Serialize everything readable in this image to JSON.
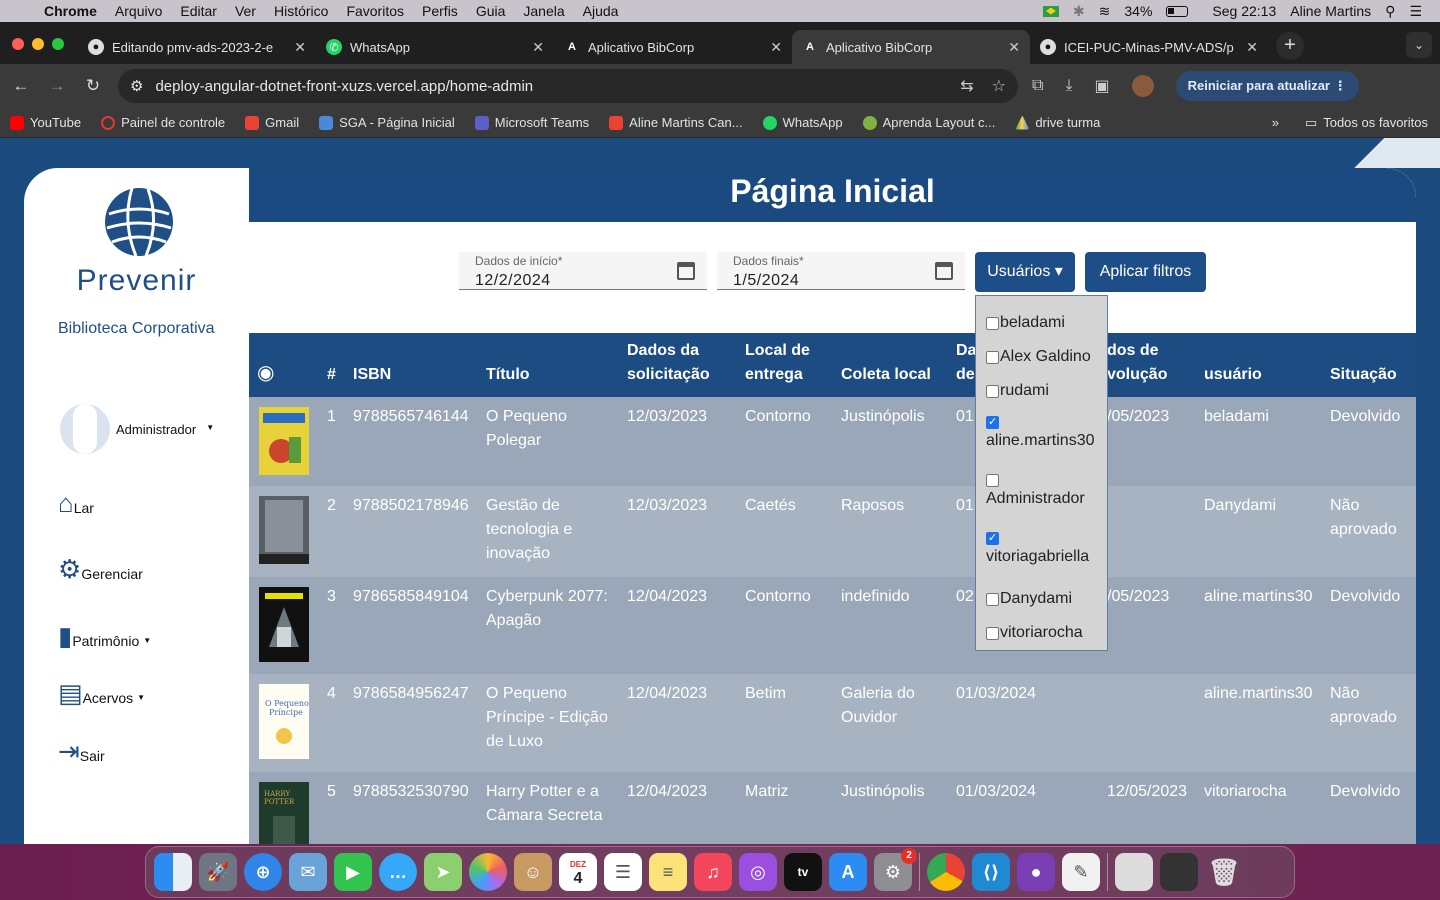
{
  "menubar": {
    "items": [
      "Chrome",
      "Arquivo",
      "Editar",
      "Ver",
      "Histórico",
      "Favoritos",
      "Perfis",
      "Guia",
      "Janela",
      "Ajuda"
    ],
    "battery": "34%",
    "clock": "Seg 22:13",
    "user": "Aline Martins"
  },
  "tabs": [
    {
      "title": "Editando pmv-ads-2023-2-e",
      "icon": "github-icon"
    },
    {
      "title": "WhatsApp",
      "icon": "whatsapp-icon"
    },
    {
      "title": "Aplicativo BibCorp",
      "icon": "angular-icon"
    },
    {
      "title": "Aplicativo BibCorp",
      "icon": "angular-icon"
    },
    {
      "title": "ICEI-PUC-Minas-PMV-ADS/p",
      "icon": "github-icon"
    }
  ],
  "toolbar": {
    "url": "deploy-angular-dotnet-front-xuzs.vercel.app/home-admin",
    "update_label": "Reiniciar para atualizar"
  },
  "bookmarks": [
    "YouTube",
    "Painel de controle",
    "Gmail",
    "SGA - Página Inicial",
    "Microsoft Teams",
    "Aline Martins Can...",
    "WhatsApp",
    "Aprenda Layout c...",
    "drive turma"
  ],
  "bookmarks_all": "Todos os favoritos",
  "sidebar": {
    "brand": "Prevenir",
    "subtitle": "Biblioteca Corporativa",
    "user": "Administrador",
    "items": [
      {
        "label": "Lar",
        "icon": "home-icon"
      },
      {
        "label": "Gerenciar",
        "icon": "gear-icon"
      },
      {
        "label": "Patrimônio",
        "icon": "book-icon"
      },
      {
        "label": "Acervos",
        "icon": "library-icon"
      },
      {
        "label": "Sair",
        "icon": "logout-icon"
      }
    ]
  },
  "main": {
    "title": "Página Inicial",
    "start_label": "Dados de início*",
    "start_value": "12/2/2024",
    "end_label": "Dados finais*",
    "end_value": "1/5/2024",
    "users_button": "Usuários ▾",
    "apply_button": "Aplicar filtros"
  },
  "dropdown": [
    {
      "label": "beladami",
      "checked": false
    },
    {
      "label": "Alex Galdino",
      "checked": false
    },
    {
      "label": "rudami",
      "checked": false
    },
    {
      "label": "aline.martins30",
      "checked": true
    },
    {
      "label": "Administrador",
      "checked": false
    },
    {
      "label": "vitoriagabriella",
      "checked": true
    },
    {
      "label": "Danydami",
      "checked": false
    },
    {
      "label": "vitoriarocha",
      "checked": false
    }
  ],
  "table": {
    "headers": {
      "num": "#",
      "isbn": "ISBN",
      "title": "Título",
      "req1": "Dados da",
      "req2": "solicitação",
      "loc1": "Local de",
      "loc2": "entrega",
      "col": "Coleta local",
      "dd1": "Da",
      "dd2": "de",
      "dev1": "dos de",
      "dev2": "volução",
      "user": "usuário",
      "status": "Situação"
    },
    "rows": [
      {
        "n": "1",
        "isbn": "9788565746144",
        "title": "O Pequeno Polegar",
        "req": "12/03/2023",
        "loc": "Contorno",
        "col": "Justinópolis",
        "dd": "01,",
        "dev": "/05/2023",
        "user": "beladami",
        "status": "Devolvido"
      },
      {
        "n": "2",
        "isbn": "9788502178946",
        "title": "Gestão de tecnologia e inovação",
        "req": "12/03/2023",
        "loc": "Caetés",
        "col": "Raposos",
        "dd": "01,",
        "dev": "",
        "user": "Danydami",
        "status": "Não aprovado"
      },
      {
        "n": "3",
        "isbn": "9786585849104",
        "title": "Cyberpunk 2077: Apagão",
        "req": "12/04/2023",
        "loc": "Contorno",
        "col": "indefinido",
        "dd": "02,",
        "dev": "/05/2023",
        "user": "aline.martins30",
        "status": "Devolvido"
      },
      {
        "n": "4",
        "isbn": "9786584956247",
        "title": "O Pequeno Príncipe - Edição de Luxo",
        "req": "12/04/2023",
        "loc": "Betim",
        "col": "Galeria do Ouvidor",
        "dd": "01/03/2024",
        "dev": "",
        "user": "aline.martins30",
        "status": "Não aprovado"
      },
      {
        "n": "5",
        "isbn": "9788532530790",
        "title": "Harry Potter e a Câmara Secreta",
        "req": "12/04/2023",
        "loc": "Matriz",
        "col": "Justinópolis",
        "dd": "01/03/2024",
        "dev": "12/05/2023",
        "user": "vitoriarocha",
        "status": "Devolvido"
      }
    ]
  },
  "dock": {
    "calendar_month": "DEZ",
    "calendar_day": "4",
    "settings_badge": "2"
  }
}
